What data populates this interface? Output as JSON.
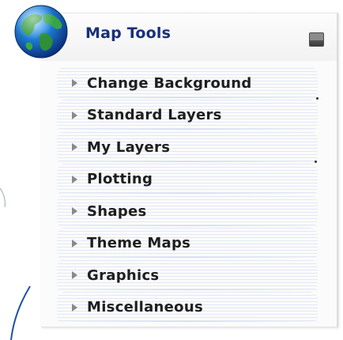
{
  "panel": {
    "title": "Map Tools",
    "icons": {
      "globe": "globe-icon",
      "minimize": "minimize-icon",
      "expand_arrow": "triangle-right-icon"
    },
    "colors": {
      "title": "#16307a",
      "label": "#1e1e1e",
      "stripe": "#cdd8ee",
      "arrow": "#888888"
    }
  },
  "menu": {
    "items": [
      {
        "label": "Change Background"
      },
      {
        "label": "Standard Layers"
      },
      {
        "label": "My Layers"
      },
      {
        "label": "Plotting"
      },
      {
        "label": "Shapes"
      },
      {
        "label": "Theme Maps"
      },
      {
        "label": "Graphics"
      },
      {
        "label": "Miscellaneous"
      }
    ]
  }
}
